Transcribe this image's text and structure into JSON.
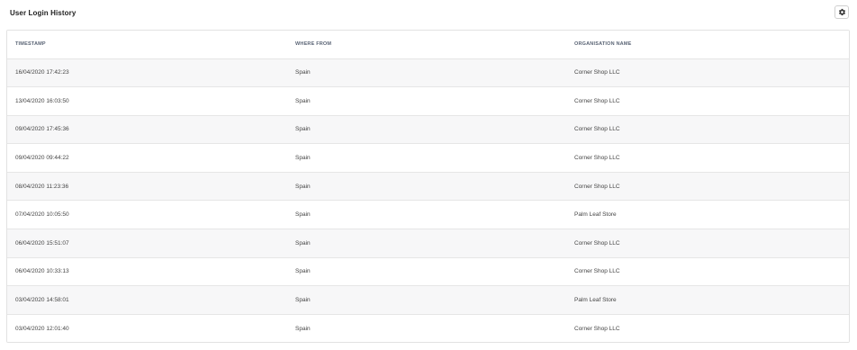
{
  "panel": {
    "title": "User Login History",
    "settings_icon": "gear-icon"
  },
  "table": {
    "columns": [
      "TIMESTAMP",
      "WHERE FROM",
      "ORGANISATION NAME"
    ],
    "rows": [
      {
        "timestamp": "16/04/2020 17:42:23",
        "where_from": "Spain",
        "organisation": "Corner Shop LLC"
      },
      {
        "timestamp": "13/04/2020 16:03:50",
        "where_from": "Spain",
        "organisation": "Corner Shop LLC"
      },
      {
        "timestamp": "09/04/2020 17:45:36",
        "where_from": "Spain",
        "organisation": "Corner Shop LLC"
      },
      {
        "timestamp": "09/04/2020 09:44:22",
        "where_from": "Spain",
        "organisation": "Corner Shop LLC"
      },
      {
        "timestamp": "08/04/2020 11:23:36",
        "where_from": "Spain",
        "organisation": "Corner Shop LLC"
      },
      {
        "timestamp": "07/04/2020 10:05:50",
        "where_from": "Spain",
        "organisation": "Palm Leaf Store"
      },
      {
        "timestamp": "06/04/2020 15:51:07",
        "where_from": "Spain",
        "organisation": "Corner Shop LLC"
      },
      {
        "timestamp": "06/04/2020 10:33:13",
        "where_from": "Spain",
        "organisation": "Corner Shop LLC"
      },
      {
        "timestamp": "03/04/2020 14:58:01",
        "where_from": "Spain",
        "organisation": "Palm Leaf Store"
      },
      {
        "timestamp": "03/04/2020 12:01:40",
        "where_from": "Spain",
        "organisation": "Corner Shop LLC"
      }
    ]
  }
}
